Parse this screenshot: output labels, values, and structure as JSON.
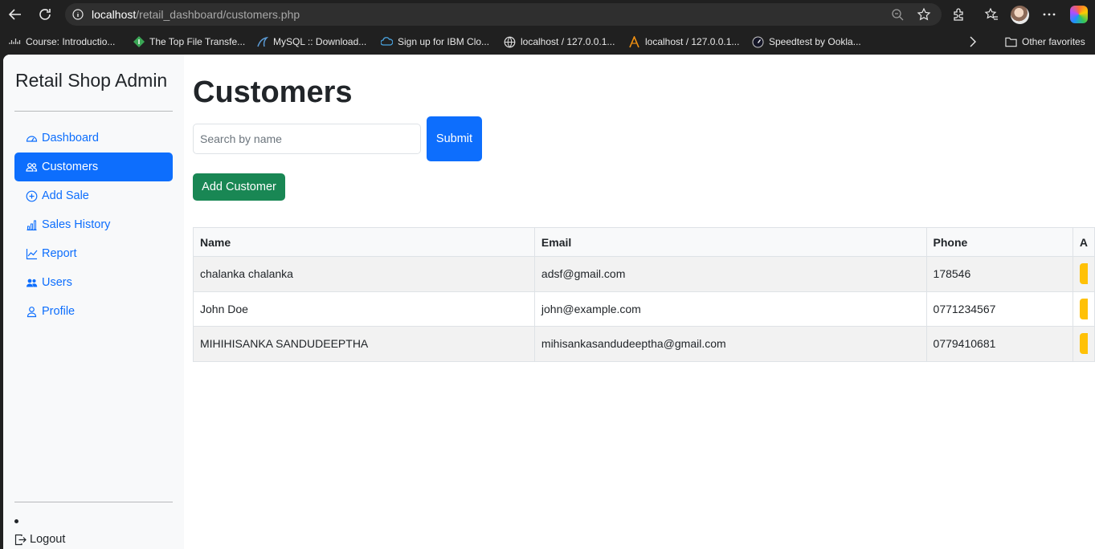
{
  "browser": {
    "url_host": "localhost",
    "url_path": "/retail_dashboard/customers.php",
    "bookmarks": [
      {
        "label": "Course: Introductio...",
        "icon": "cisco-icon"
      },
      {
        "label": "The Top File Transfe...",
        "icon": "filetransfer-icon"
      },
      {
        "label": "MySQL :: Download...",
        "icon": "mysql-icon"
      },
      {
        "label": "Sign up for IBM Clo...",
        "icon": "ibm-cloud-icon"
      },
      {
        "label": "localhost / 127.0.0.1...",
        "icon": "globe-icon"
      },
      {
        "label": "localhost / 127.0.0.1...",
        "icon": "phpmyadmin-icon"
      },
      {
        "label": "Speedtest by Ookla...",
        "icon": "speedtest-icon"
      }
    ],
    "other_favorites": "Other favorites"
  },
  "sidebar": {
    "brand": "Retail Shop Admin",
    "items": [
      {
        "label": "Dashboard",
        "icon": "speedometer-icon",
        "active": false
      },
      {
        "label": "Customers",
        "icon": "people-icon",
        "active": true
      },
      {
        "label": "Add Sale",
        "icon": "plus-circle-icon",
        "active": false
      },
      {
        "label": "Sales History",
        "icon": "bar-chart-icon",
        "active": false
      },
      {
        "label": "Report",
        "icon": "line-chart-icon",
        "active": false
      },
      {
        "label": "Users",
        "icon": "people-fill-icon",
        "active": false
      },
      {
        "label": "Profile",
        "icon": "person-icon",
        "active": false
      }
    ],
    "logout": "Logout"
  },
  "main": {
    "title": "Customers",
    "search_placeholder": "Search by name",
    "submit_label": "Submit",
    "add_label": "Add Customer",
    "table": {
      "headers": [
        "Name",
        "Email",
        "Phone",
        "A"
      ],
      "rows": [
        [
          "chalanka chalanka",
          "adsf@gmail.com",
          "178546"
        ],
        [
          "John Doe",
          "john@example.com",
          "0771234567"
        ],
        [
          "MIHIHISANKA SANDUDEEPTHA",
          "mihisankasandudeeptha@gmail.com",
          "0779410681"
        ]
      ]
    }
  },
  "colors": {
    "primary": "#0d6efd",
    "success": "#198754",
    "warning": "#ffc107",
    "chrome": "#202020"
  }
}
